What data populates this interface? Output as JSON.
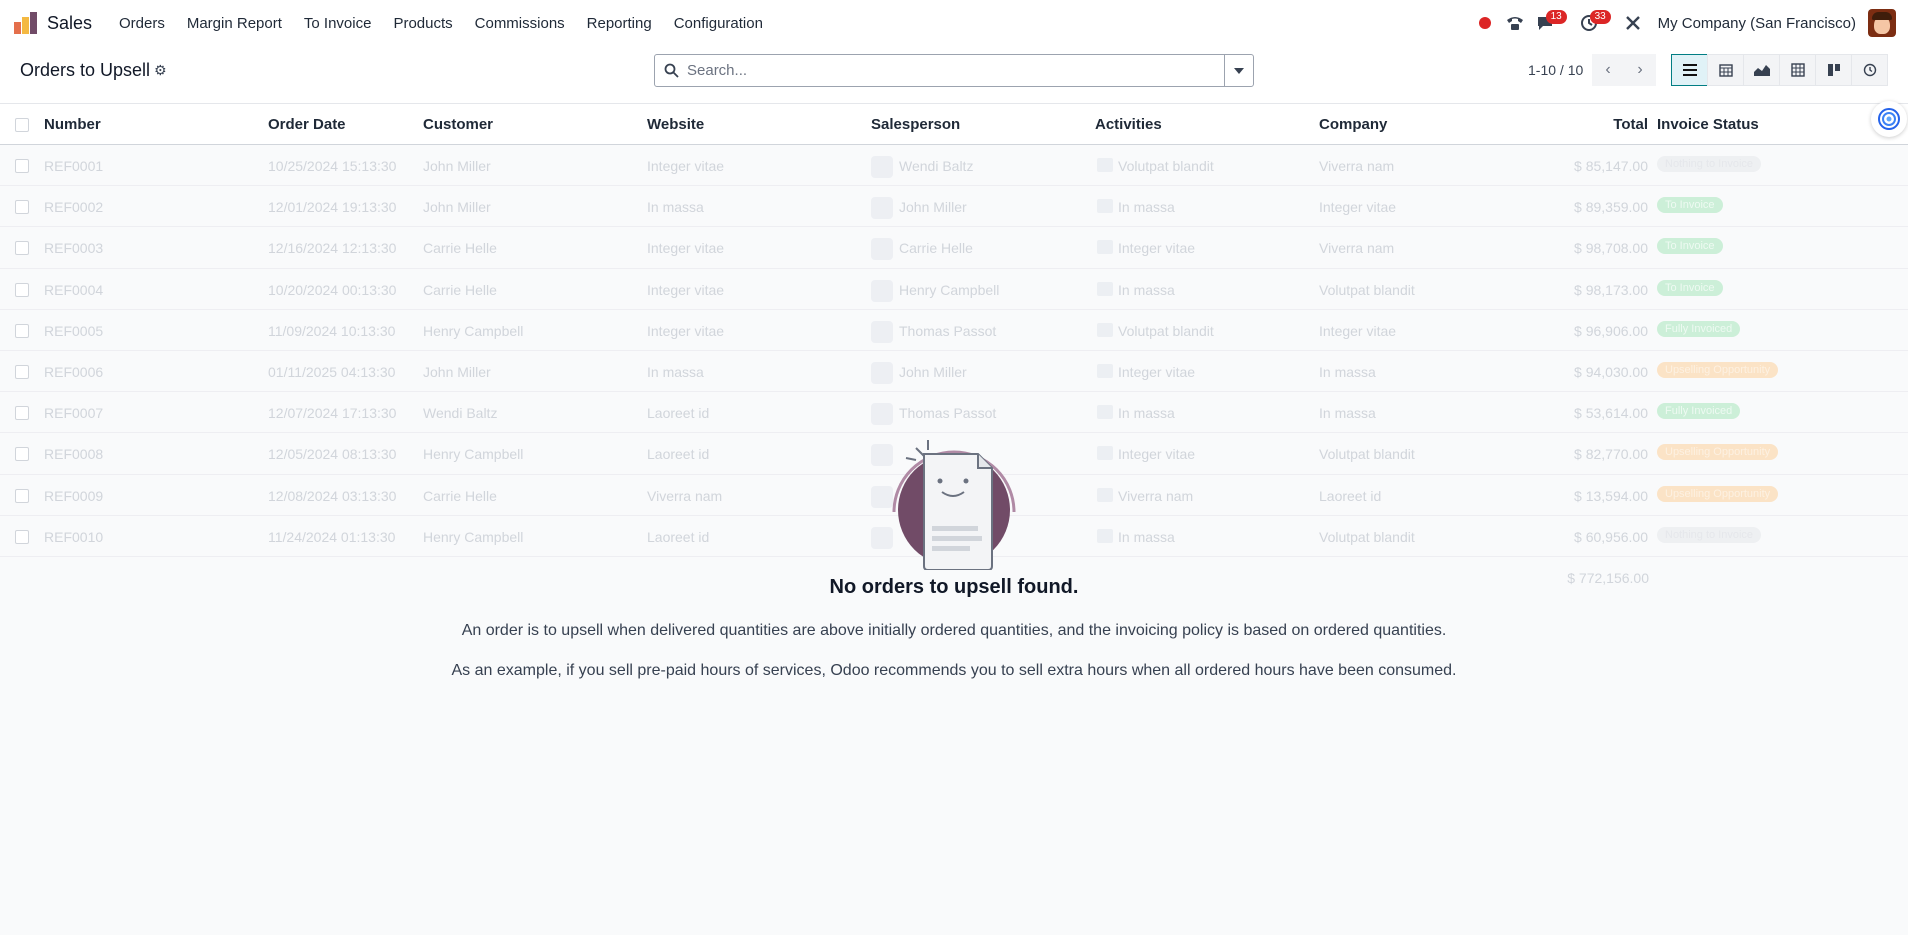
{
  "app": {
    "name": "Sales"
  },
  "menu": [
    "Orders",
    "Margin Report",
    "To Invoice",
    "Products",
    "Commissions",
    "Reporting",
    "Configuration"
  ],
  "systray": {
    "messages_badge": "13",
    "activities_badge": "33",
    "company": "My Company (San Francisco)"
  },
  "control": {
    "title": "Orders to Upsell",
    "search_placeholder": "Search...",
    "pager": "1-10 / 10"
  },
  "columns": {
    "number": "Number",
    "order_date": "Order Date",
    "customer": "Customer",
    "website": "Website",
    "salesperson": "Salesperson",
    "activities": "Activities",
    "company": "Company",
    "total": "Total",
    "invoice_status": "Invoice Status"
  },
  "rows": [
    {
      "number": "REF0001",
      "date": "10/25/2024 15:13:30",
      "customer": "John Miller",
      "website": "Integer vitae",
      "salesperson": "Wendi Baltz",
      "activity": "Volutpat blandit",
      "company": "Viverra nam",
      "total": "$ 85,147.00",
      "status": "Nothing to Invoice",
      "status_kind": "gray"
    },
    {
      "number": "REF0002",
      "date": "12/01/2024 19:13:30",
      "customer": "John Miller",
      "website": "In massa",
      "salesperson": "John Miller",
      "activity": "In massa",
      "company": "Integer vitae",
      "total": "$ 89,359.00",
      "status": "To Invoice",
      "status_kind": "green"
    },
    {
      "number": "REF0003",
      "date": "12/16/2024 12:13:30",
      "customer": "Carrie Helle",
      "website": "Integer vitae",
      "salesperson": "Carrie Helle",
      "activity": "Integer vitae",
      "company": "Viverra nam",
      "total": "$ 98,708.00",
      "status": "To Invoice",
      "status_kind": "green"
    },
    {
      "number": "REF0004",
      "date": "10/20/2024 00:13:30",
      "customer": "Carrie Helle",
      "website": "Integer vitae",
      "salesperson": "Henry Campbell",
      "activity": "In massa",
      "company": "Volutpat blandit",
      "total": "$ 98,173.00",
      "status": "To Invoice",
      "status_kind": "green"
    },
    {
      "number": "REF0005",
      "date": "11/09/2024 10:13:30",
      "customer": "Henry Campbell",
      "website": "Integer vitae",
      "salesperson": "Thomas Passot",
      "activity": "Volutpat blandit",
      "company": "Integer vitae",
      "total": "$ 96,906.00",
      "status": "Fully Invoiced",
      "status_kind": "green"
    },
    {
      "number": "REF0006",
      "date": "01/11/2025 04:13:30",
      "customer": "John Miller",
      "website": "In massa",
      "salesperson": "John Miller",
      "activity": "Integer vitae",
      "company": "In massa",
      "total": "$ 94,030.00",
      "status": "Upselling Opportunity",
      "status_kind": "orange"
    },
    {
      "number": "REF0007",
      "date": "12/07/2024 17:13:30",
      "customer": "Wendi Baltz",
      "website": "Laoreet id",
      "salesperson": "Thomas Passot",
      "activity": "In massa",
      "company": "In massa",
      "total": "$ 53,614.00",
      "status": "Fully Invoiced",
      "status_kind": "green"
    },
    {
      "number": "REF0008",
      "date": "12/05/2024 08:13:30",
      "customer": "Henry Campbell",
      "website": "Laoreet id",
      "salesperson": "",
      "activity": "Integer vitae",
      "company": "Volutpat blandit",
      "total": "$ 82,770.00",
      "status": "Upselling Opportunity",
      "status_kind": "orange"
    },
    {
      "number": "REF0009",
      "date": "12/08/2024 03:13:30",
      "customer": "Carrie Helle",
      "website": "Viverra nam",
      "salesperson": "",
      "activity": "Viverra nam",
      "company": "Laoreet id",
      "total": "$ 13,594.00",
      "status": "Upselling Opportunity",
      "status_kind": "orange"
    },
    {
      "number": "REF0010",
      "date": "11/24/2024 01:13:30",
      "customer": "Henry Campbell",
      "website": "Laoreet id",
      "salesperson": "",
      "activity": "In massa",
      "company": "Volutpat blandit",
      "total": "$ 60,956.00",
      "status": "Nothing to Invoice",
      "status_kind": "gray"
    }
  ],
  "grand_total": "$ 772,156.00",
  "helper": {
    "title": "No orders to upsell found.",
    "p1": "An order is to upsell when delivered quantities are above initially ordered quantities, and the invoicing policy is based on ordered quantities.",
    "p2": "As an example, if you sell pre-paid hours of services, Odoo recommends you to sell extra hours when all ordered hours have been consumed."
  },
  "colors": {
    "brand": "#714b67",
    "accent": "#017e84",
    "badge": "#dc2626"
  }
}
